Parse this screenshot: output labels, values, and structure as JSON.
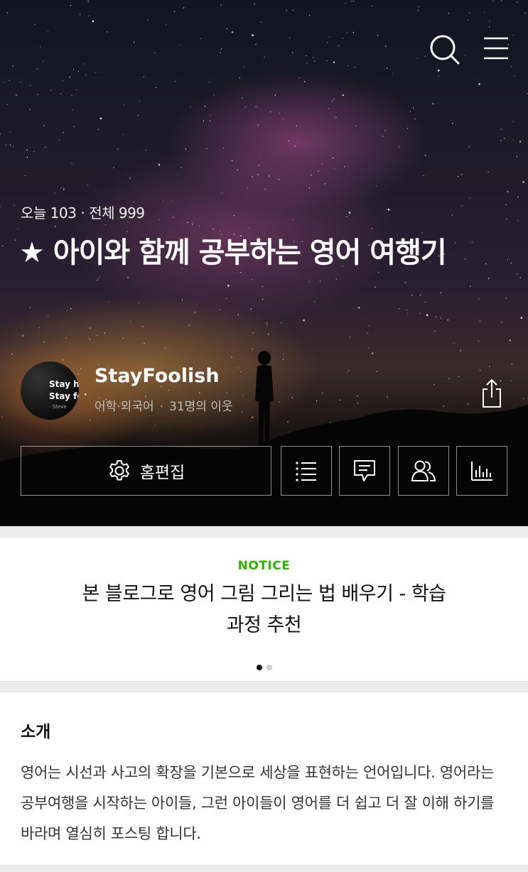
{
  "header": {
    "search_icon": "search-icon",
    "menu_icon": "hamburger-menu-icon"
  },
  "stats": {
    "today": "오늘 103",
    "total": "전체 999"
  },
  "blog": {
    "title": "★ 아이와 함께 공부하는 영어 여행기",
    "name": "StayFoolish",
    "category": "어학·외국어",
    "neighbors": "31명의 이웃",
    "avatar_text": [
      "Stay hu",
      "Stay for",
      "- Steve"
    ]
  },
  "toolbar": {
    "home_edit_label": "홈편집",
    "icons": [
      "gear-icon",
      "list-icon",
      "comment-icon",
      "neighbors-icon",
      "stats-icon",
      "share-icon"
    ]
  },
  "notice": {
    "label": "NOTICE",
    "title": "본 블로그로 영어 그림 그리는 법 배우기 - 학습 과정 추천",
    "pages": 2,
    "active_page": 1
  },
  "intro": {
    "heading": "소개",
    "body": "영어는 시선과  사고의 확장을  기본으로 세상을  표현하는 언어입니다. 영어라는 공부여행을 시작하는 아이들,  그런 아이들이 영어를  더 쉽고 더 잘 이해 하기를 바라며 열심히 포스팅 합니다."
  },
  "colors": {
    "accent_green": "#2db400",
    "text_dark": "#111111"
  }
}
